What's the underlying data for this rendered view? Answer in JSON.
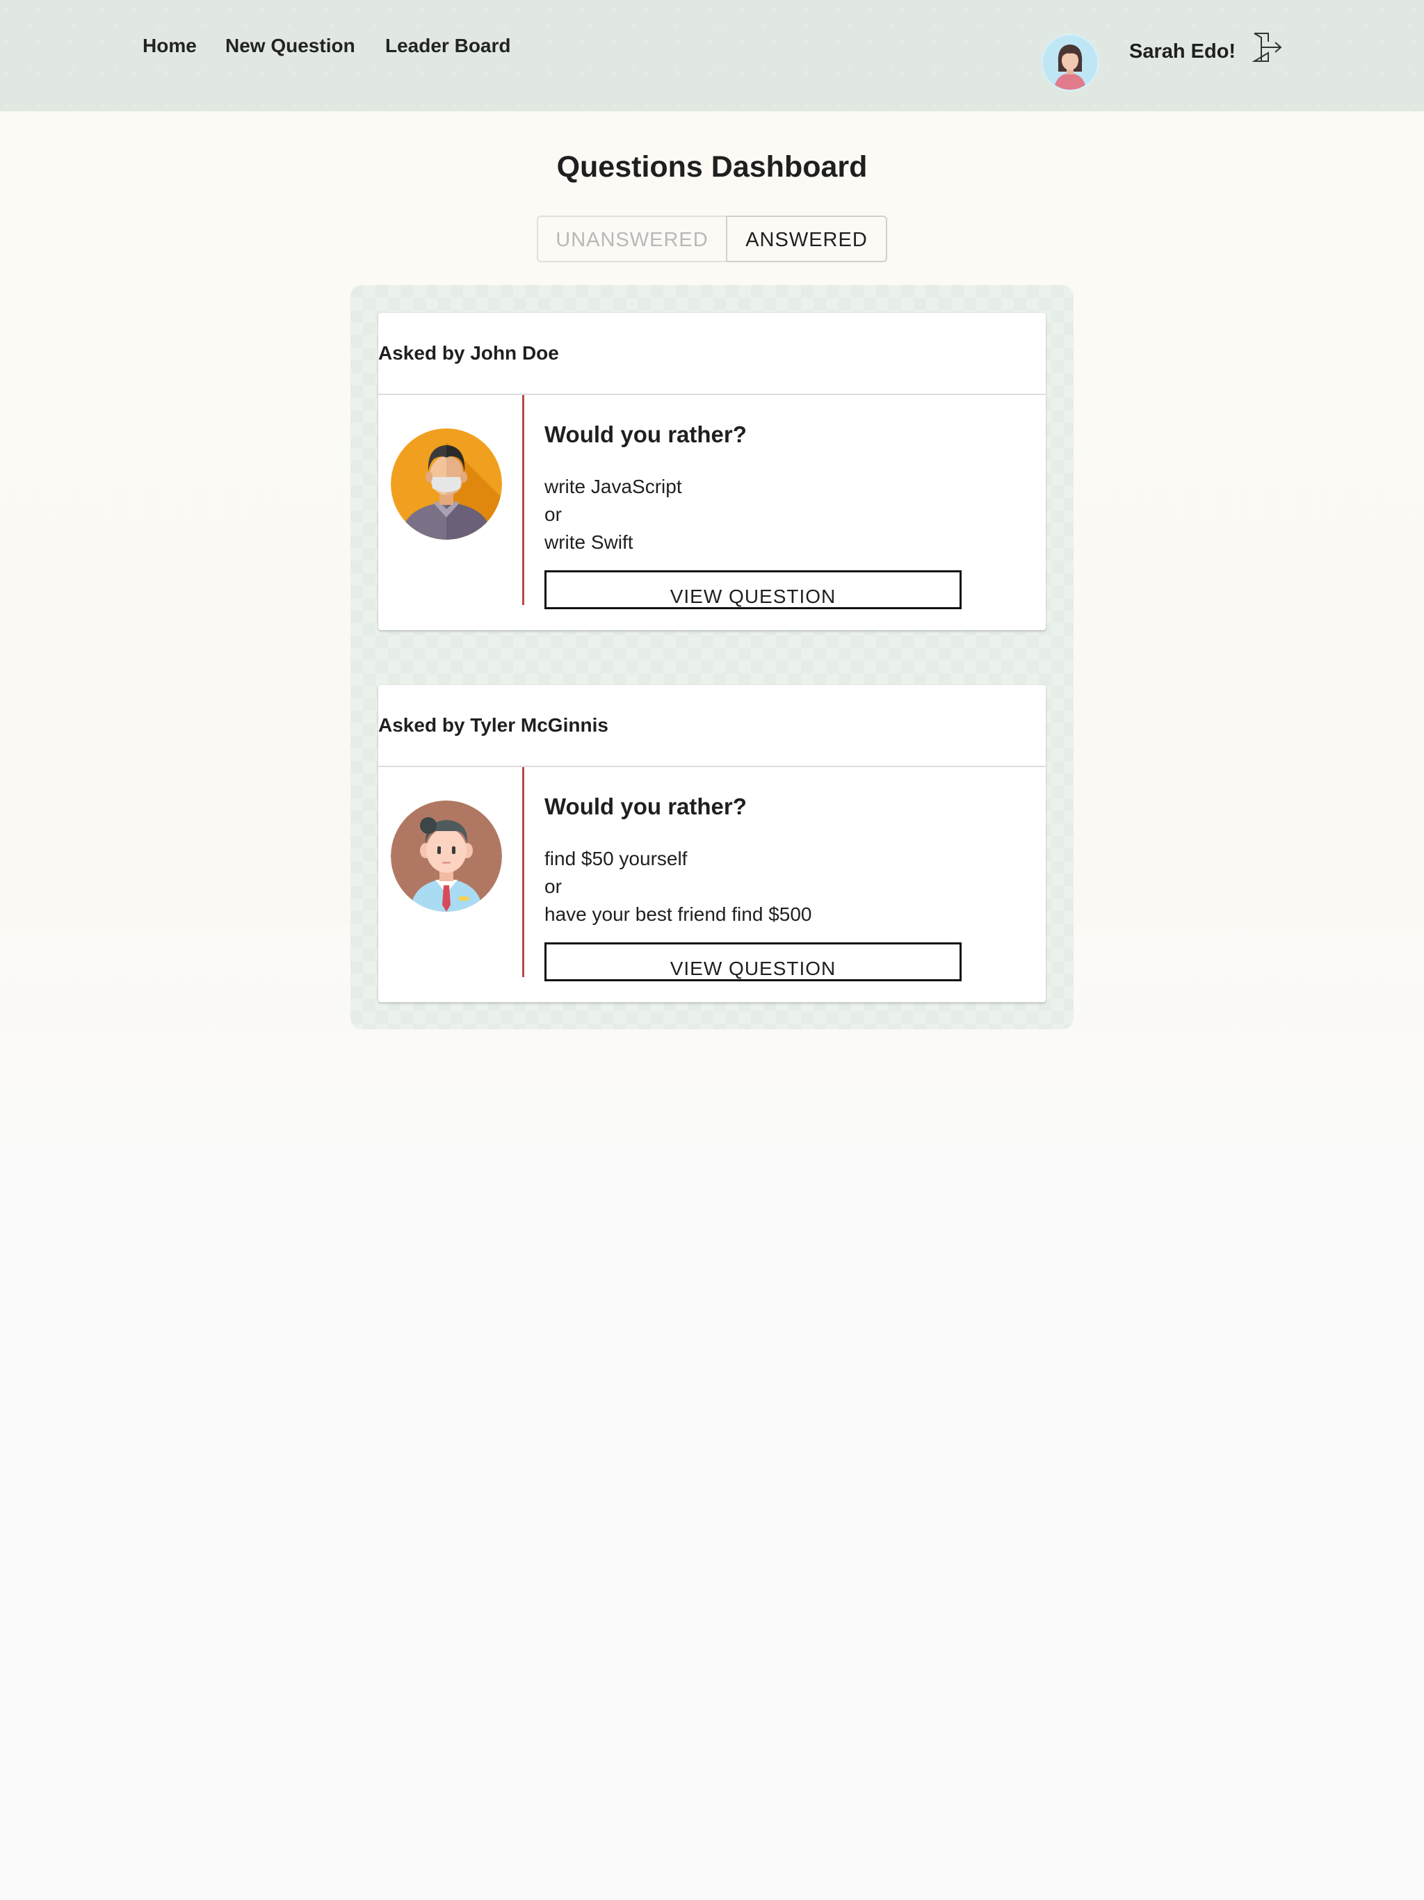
{
  "nav": {
    "home_label": "Home",
    "new_question_label": "New Question",
    "leader_board_label": "Leader Board",
    "user_name": "Sarah Edo!",
    "user_avatar_icon": "woman-avatar-icon",
    "logout_icon": "logout-door-icon"
  },
  "dashboard": {
    "title": "Questions Dashboard",
    "tabs": [
      {
        "label": "UNANSWERED",
        "active": false
      },
      {
        "label": "ANSWERED",
        "active": true
      }
    ]
  },
  "questions": [
    {
      "asked_by": "Asked by John Doe",
      "avatar_icon": "man-avatar-icon",
      "avatar_color": "#f0a01e",
      "prompt": "Would you rather?",
      "option_one": "write JavaScript",
      "separator": "or",
      "option_two": "write Swift",
      "button_label": "VIEW QUESTION"
    },
    {
      "asked_by": "Asked by Tyler McGinnis",
      "avatar_icon": "boy-avatar-icon",
      "avatar_color": "#b07863",
      "prompt": "Would you rather?",
      "option_one": "find $50 yourself",
      "separator": "or",
      "option_two": "have your best friend find $500",
      "button_label": "VIEW QUESTION"
    }
  ],
  "colors": {
    "navbar_bg": "#e1e8e1",
    "panel_bg": "#e6ede6",
    "divider_accent": "#b94a4a",
    "inactive_tab_text": "#b8b8b8"
  }
}
